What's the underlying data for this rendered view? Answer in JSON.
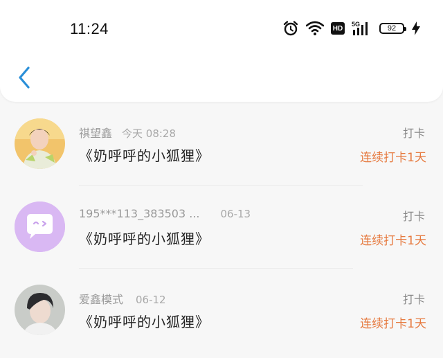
{
  "status_bar": {
    "time": "11:24",
    "network": "5G",
    "hd": "HD",
    "battery": "92",
    "icons": [
      "alarm-icon",
      "wifi-icon",
      "hd-icon",
      "signal-icon",
      "battery-icon",
      "charging-icon"
    ]
  },
  "nav": {
    "back_icon": "chevron-left-icon"
  },
  "colors": {
    "accent": "#1e88e5",
    "streak": "#e6793e",
    "muted": "#9a9a9a"
  },
  "items": [
    {
      "name": "祺望鑫",
      "date": "今天 08:28",
      "title": "《奶呼呼的小狐狸》",
      "status": "打卡",
      "streak": "连续打卡1天",
      "avatar": "photo-avatar"
    },
    {
      "name": "195***113_383503 ...",
      "date": "06-13",
      "title": "《奶呼呼的小狐狸》",
      "status": "打卡",
      "streak": "连续打卡1天",
      "avatar": "chat-bubble-avatar"
    },
    {
      "name": "爱鑫模式",
      "date": "06-12",
      "title": "《奶呼呼的小狐狸》",
      "status": "打卡",
      "streak": "连续打卡1天",
      "avatar": "photo-avatar"
    }
  ]
}
